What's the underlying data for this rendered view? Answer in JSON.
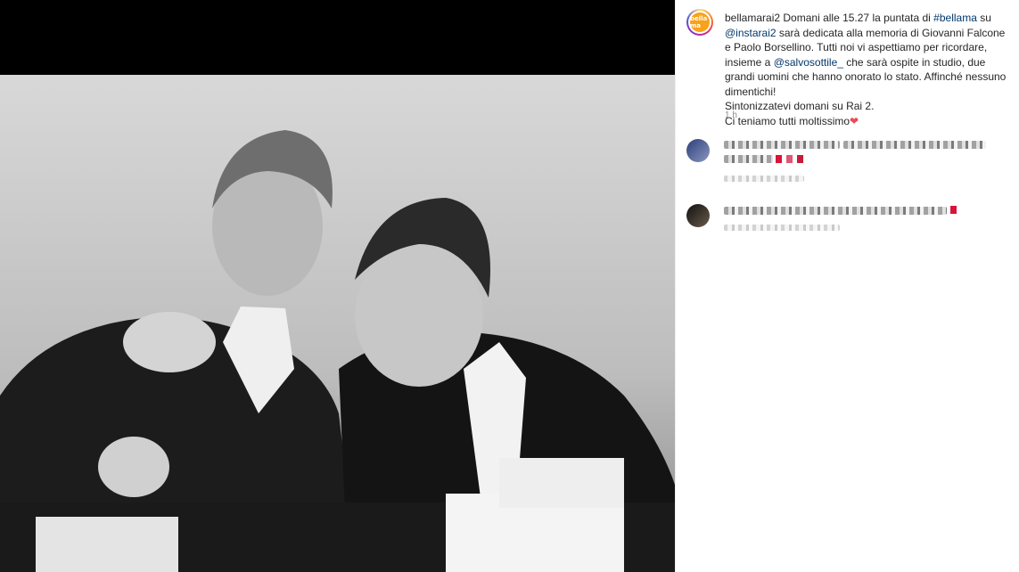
{
  "post": {
    "username": "bellamarai2",
    "caption_intro": " Domani alle 15.27 la puntata di ",
    "hashtag": "#bellama",
    "caption_mid1": " su",
    "mention1": "@instarai2",
    "caption_body": " sarà dedicata alla memoria di Giovanni Falcone e Paolo Borsellino. Tutti noi vi aspettiamo per ricordare, insieme a ",
    "mention2": "@salvosottile_",
    "caption_end": " che sarà ospite in studio, due grandi uomini che hanno onorato lo stato. Affinché nessuno dimentichi!\nSintonizzatevi domani su Rai 2.\nCi teniamo tutti moltissimo",
    "heart": "❤",
    "time": "1 h",
    "avatar_text": "bella ma"
  },
  "colors": {
    "link": "#00376b",
    "text": "#262626",
    "muted": "#8e8e8e",
    "heart": "#ed4956"
  }
}
